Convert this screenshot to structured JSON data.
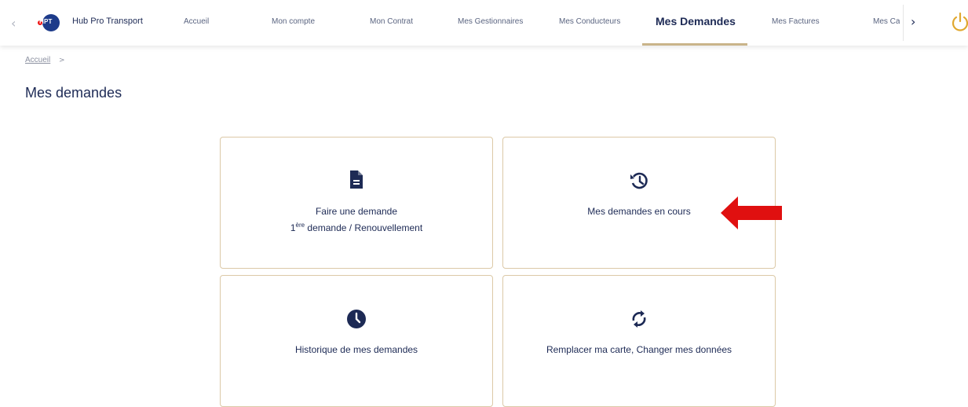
{
  "nav": {
    "brand": "Hub Pro Transport",
    "logo_text": "HPT",
    "items": [
      {
        "label": "Accueil"
      },
      {
        "label": "Mon compte"
      },
      {
        "label": "Mon Contrat"
      },
      {
        "label": "Mes Gestionnaires"
      },
      {
        "label": "Mes Conducteurs"
      },
      {
        "label": "Mes Demandes"
      },
      {
        "label": "Mes Factures"
      },
      {
        "label": "Mes Ca"
      }
    ],
    "active": "Mes Demandes",
    "prev_icon": "chevron-left-icon",
    "next_icon": "chevron-right-icon",
    "power_icon": "power-icon"
  },
  "breadcrumb": {
    "home": "Accueil",
    "separator": ">"
  },
  "page": {
    "title": "Mes demandes"
  },
  "cards": [
    {
      "icon": "document-icon",
      "label": "Faire une demande",
      "sub_prefix": "1",
      "sub_sup": "ère",
      "sub_rest": " demande / Renouvellement"
    },
    {
      "icon": "history-icon",
      "label": "Mes demandes en cours"
    },
    {
      "icon": "clock-icon",
      "label": "Historique de mes demandes"
    },
    {
      "icon": "refresh-icon",
      "label": "Remplacer ma carte, Changer mes données"
    }
  ],
  "colors": {
    "accent": "#1d2a55",
    "card_border": "#dcc9a7",
    "underline": "#c9b48a",
    "annotation": "#e01010",
    "power": "#e0a830"
  }
}
